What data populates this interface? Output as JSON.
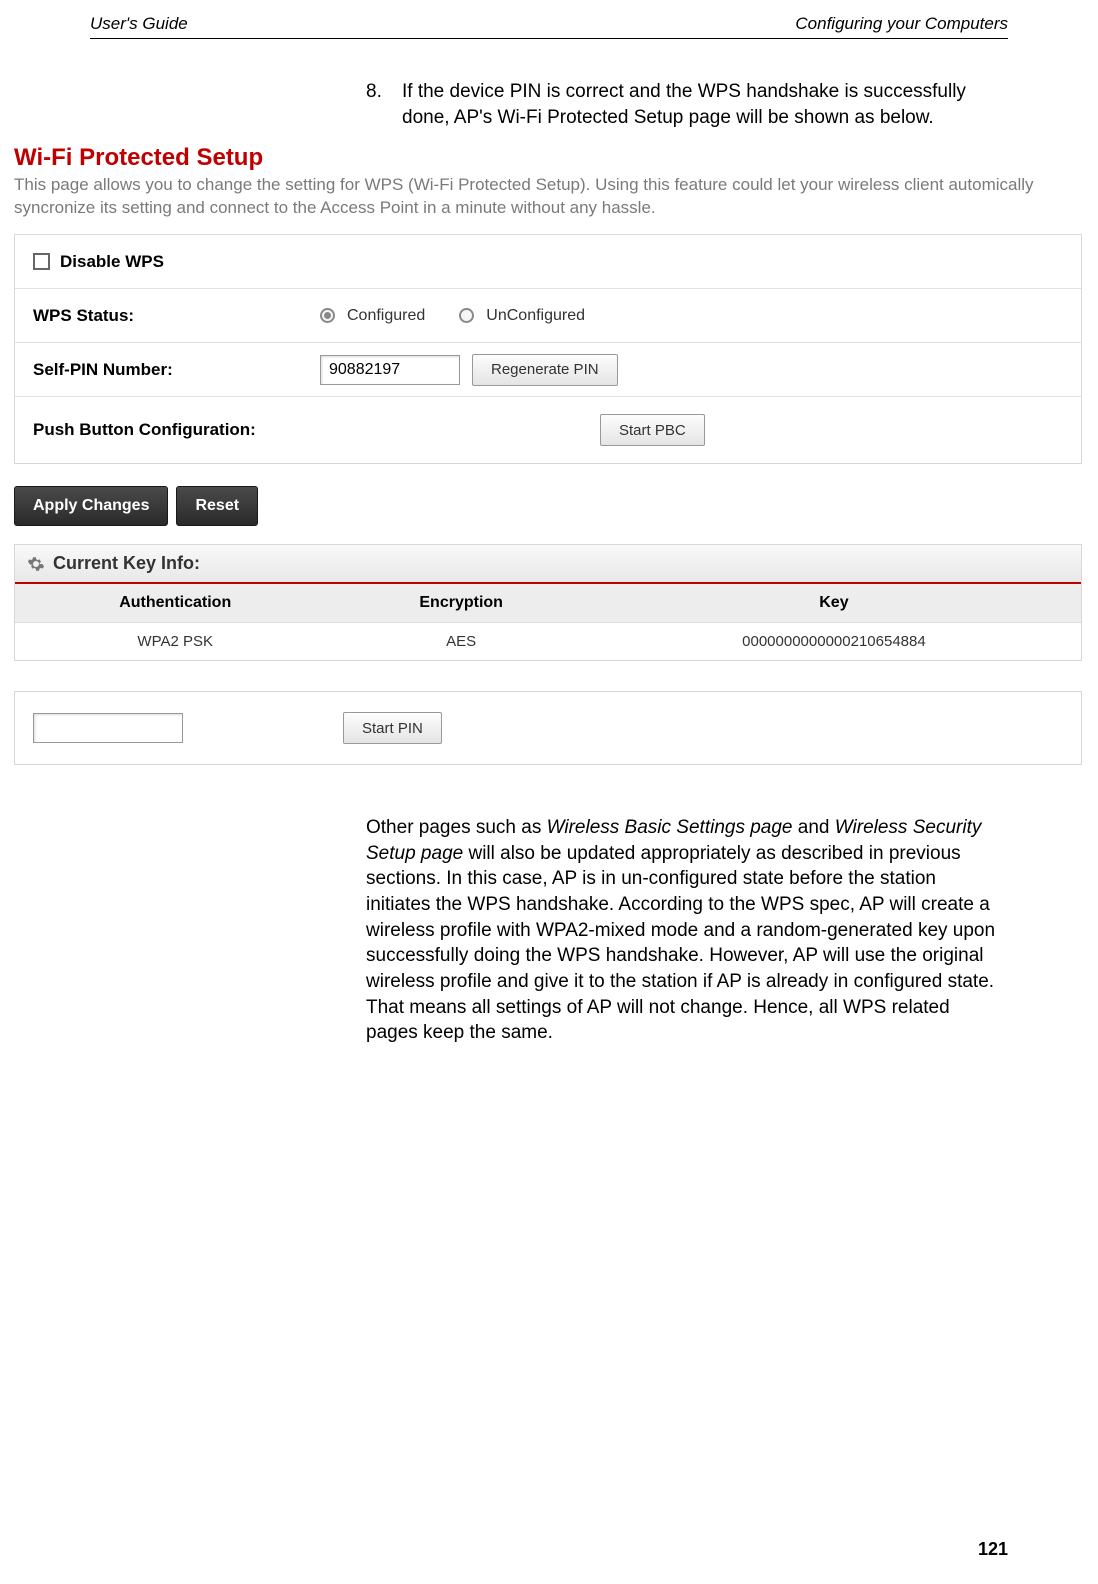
{
  "header": {
    "left": "User's Guide",
    "right": "Configuring your Computers"
  },
  "step": {
    "number": "8.",
    "text": "If the device PIN is correct and the WPS handshake is successfully done, AP's Wi-Fi Protected Setup page will be shown as below."
  },
  "wps": {
    "title": "Wi-Fi Protected Setup",
    "description": "This page allows you to change the setting for WPS (Wi-Fi Protected Setup). Using this feature could let your wireless client automically syncronize its setting and connect to the Access Point in a minute without any hassle.",
    "disable_label": "Disable WPS",
    "status_label": "WPS Status:",
    "status_options": {
      "configured": "Configured",
      "unconfigured": "UnConfigured"
    },
    "selfpin_label": "Self-PIN Number:",
    "selfpin_value": "90882197",
    "regenerate_btn": "Regenerate PIN",
    "pbc_label": "Push Button Configuration:",
    "pbc_btn": "Start PBC",
    "apply_btn": "Apply Changes",
    "reset_btn": "Reset",
    "keyinfo_title": "Current Key Info:",
    "keyinfo_cols": {
      "auth": "Authentication",
      "enc": "Encryption",
      "key": "Key"
    },
    "keyinfo_row": {
      "auth": "WPA2 PSK",
      "enc": "AES",
      "key": "0000000000000210654884"
    },
    "start_pin_btn": "Start PIN"
  },
  "paragraph": {
    "p1a": "Other pages such as ",
    "p1b": "Wireless Basic Settings page",
    "p1c": " and ",
    "p1d": "Wireless Security Setup page",
    "p1e": " will also be updated appropriately as described in previous sections. In this case, AP is in un-configured state before the station initiates the WPS handshake. According to the WPS spec, AP will create a wireless profile with WPA2-mixed mode and a random-generated key upon successfully doing the WPS handshake. However, AP will use the original wireless profile and give it to the station if AP is already in configured state. That means all settings of AP will not change. Hence, all WPS related pages keep the same."
  },
  "page_number": "121"
}
